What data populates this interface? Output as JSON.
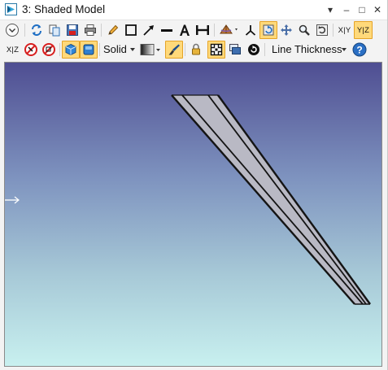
{
  "window": {
    "title": "3: Shaded Model",
    "controls": {
      "menu": "▾",
      "minimize": "–",
      "maximize": "□",
      "close": "✕"
    }
  },
  "toolbar1": {
    "axis_x_y": "X|Y",
    "axis_y_z": "Y|Z"
  },
  "toolbar2": {
    "axis_x_z": "X|Z",
    "render_mode": "Solid",
    "line_thickness": "Line Thickness",
    "help": "?"
  },
  "viewport": {
    "background_top": "#4f4e92",
    "background_bottom": "#c8f0ef",
    "model_fill": "#b9b9c4",
    "model_edge": "#141414"
  },
  "colors": {
    "active_button_bg": "#ffd97a",
    "active_button_border": "#e5a326",
    "blue_accent": "#1f6fc4",
    "red_accent": "#d71f1f"
  },
  "icons": [
    "app-icon",
    "view-options-icon",
    "refresh-icon",
    "copy-icon",
    "save-icon",
    "print-icon",
    "pencil-icon",
    "rectangle-icon",
    "arrow-icon",
    "line-icon",
    "text-icon",
    "dimension-icon",
    "rotate-axes-icon",
    "axes-icon",
    "rotate-view-icon",
    "pan-icon",
    "zoom-icon",
    "reset-view-icon",
    "clear-annotations-icon",
    "clear-all-icon",
    "shaded-cube-icon",
    "solid-box-icon",
    "gradient-icon",
    "brush-icon",
    "lock-icon",
    "fit-view-icon",
    "layers-icon",
    "recenter-icon",
    "help-icon"
  ]
}
